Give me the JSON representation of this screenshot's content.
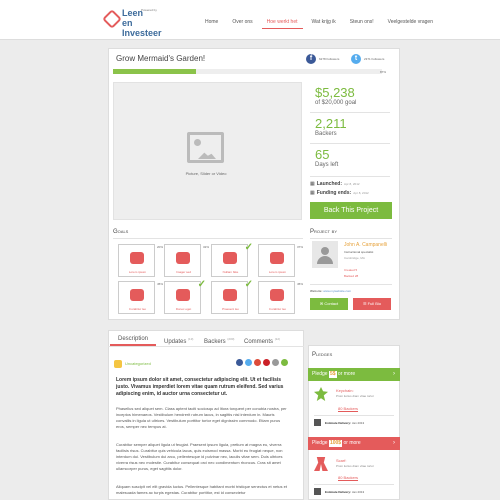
{
  "header": {
    "logo": {
      "line1": "Leen",
      "line2": "en Investeer",
      "sub": "Powered by"
    },
    "nav": [
      "Home",
      "Over ons",
      "Hoe werkt het",
      "Wat krijg ik",
      "Steun ons!",
      "Veelgestelde vragen"
    ],
    "active_nav": "Hoe werkt het"
  },
  "project": {
    "title": "Grow Mermaid's Garden!",
    "facebook_followers": "6278 Followers",
    "twitter_followers": "2371 Followers",
    "progress_fraction": 0.31,
    "progress_label": "87%",
    "media_label": "Picture, Slider or Video"
  },
  "stats": {
    "pledged": "$5,238",
    "goal": "of $20,000 goal",
    "backers": "2,211",
    "backers_label": "Backers",
    "days": "65",
    "days_label": "Days left"
  },
  "dates": {
    "launched_label": "Launched:",
    "launched": "Apr 8, 2012",
    "ends_label": "Funding ends:",
    "ends": "Apr 8, 2012"
  },
  "back_button": "Back This Project",
  "goals": {
    "heading": "Goals",
    "items": [
      {
        "label": "Lorem ipsum",
        "pct": "20%",
        "check": false
      },
      {
        "label": "Imager sed",
        "pct": "32%",
        "check": false
      },
      {
        "label": "Nullam bike",
        "pct": "",
        "check": true
      },
      {
        "label": "Lorem ipsum",
        "pct": "37%",
        "check": false
      },
      {
        "label": "Curabitur leo",
        "pct": "45%",
        "check": false
      },
      {
        "label": "Donec eget",
        "pct": "",
        "check": true
      },
      {
        "label": "Praesent leo",
        "pct": "",
        "check": true
      },
      {
        "label": "Curabitur leo",
        "pct": "45%",
        "check": false
      }
    ]
  },
  "creator": {
    "heading": "Project by",
    "name": "John A. Campanelli",
    "title": "Instructional specialist",
    "location": "Cambridge, MA",
    "created": "Created 5",
    "backed": "Backed 28",
    "website_label": "Website:",
    "website": "www.mywebsite.com",
    "contact_button": "Contact",
    "bio_button": "Full Bio"
  },
  "tabs": [
    {
      "label": "Description",
      "count": ""
    },
    {
      "label": "Updates",
      "count": "(13)"
    },
    {
      "label": "Backers",
      "count": "(230)"
    },
    {
      "label": "Comments",
      "count": "(12)"
    }
  ],
  "description": {
    "category": "Uncategorized",
    "lead": "Lorem ipsum dolor sit amet, consectetur adipiscing elit. Ut et facilisis justo. Vivamus imperdiet lorem vitae quam rutrum eleifend. Sed varius adipiscing enim, id auctor urna consectetur ut.",
    "p1": "Phasellus sed aliquet sem. Class aptent taciti sociosqu ad litora torquent per conubia nostra, per inceptos himenaeos. Vestibulum hendrerit rutrum lacus, in sagittis nisl interdum in. Mauris convallis in ligula ut ultrices. Vestibulum porttitor tortor eget dignissim commodo. Etiam purus eros, semper nec tempus at.",
    "p2": "Curabitur semper aliquet ligula ut feugiat. Praesent ipsum ligula, pretium at magna eu, viverra facilisis risus. Curabitur quis vehicula lacus, quis euismod massa. Morbi eu feugiat neque, non interdum dui. Vestibulum dui arcu, pellentesque id pulvinar nec, iaculis vitae sem. Duis ultrices viverra risus nec molestie. Curabitur consequat orci nec condimentum rhoncus. Cras sit amet ullamcorper purus, eget sagittis dolor.",
    "p3": "Aliquam suscipit vel elit gravida luctus. Pellentesque habitant morbi tristique senectus et netus et malesuada fames ac turpis egestas. Curabitur porttitor, est id consectetur"
  },
  "pledges": {
    "heading": "Pledges",
    "items": [
      {
        "prefix": "Pledge",
        "amount": "5$",
        "suffix": "or more",
        "name_label": "Keychain:",
        "desc": "Proin luctus diam vitae tortor",
        "backers": "80 Backers",
        "delivery_label": "Estimate Delivery:",
        "delivery": "Jan 2013"
      },
      {
        "prefix": "Pledge",
        "amount": "100$",
        "suffix": "or more",
        "name_label": "Scarf:",
        "desc": "Proin luctus diam vitae tortor",
        "backers": "80 Backers",
        "delivery_label": "Estimate Delivery:",
        "delivery": "Jan 2013"
      }
    ]
  },
  "colors": {
    "accent": "#e45b5b",
    "success": "#7cbb3f",
    "highlight": "#e6a23c",
    "facebook": "#3b5998",
    "twitter": "#55acee"
  }
}
